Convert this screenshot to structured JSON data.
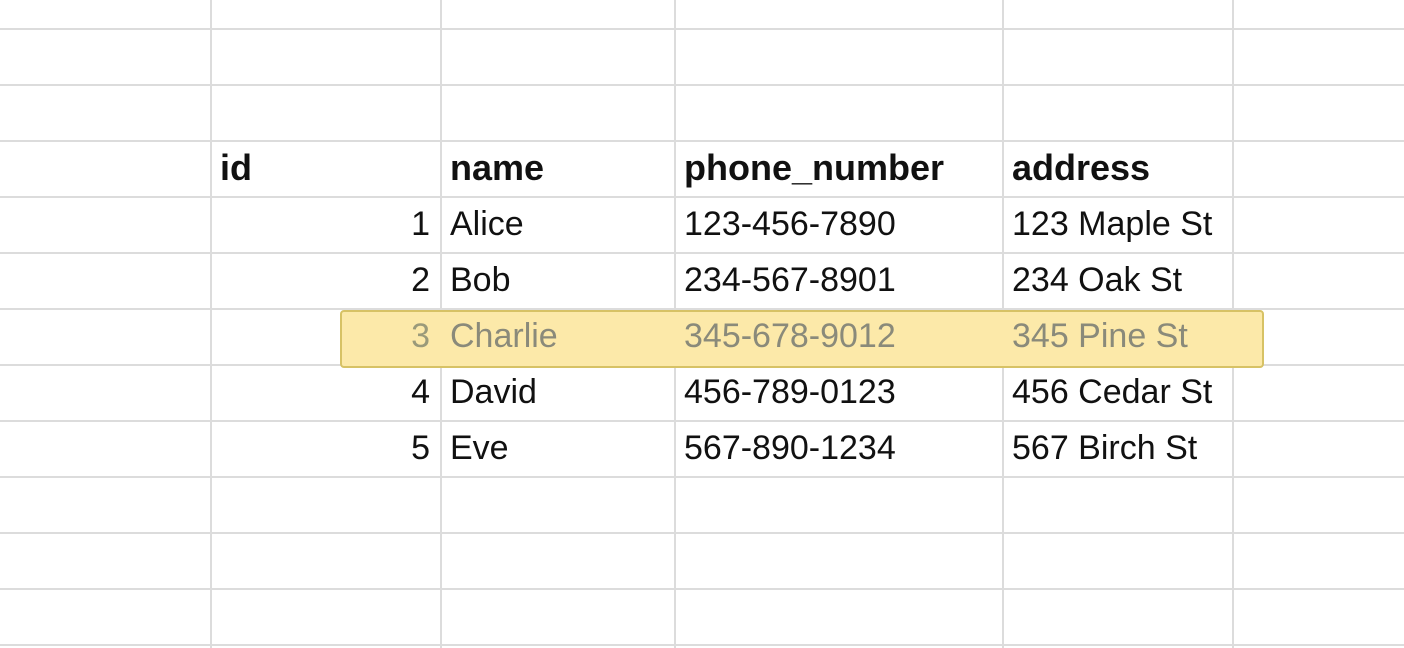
{
  "table": {
    "headers": [
      "id",
      "name",
      "phone_number",
      "address"
    ],
    "rows": [
      {
        "id": "1",
        "name": "Alice",
        "phone_number": "123-456-7890",
        "address": "123 Maple St"
      },
      {
        "id": "2",
        "name": "Bob",
        "phone_number": "234-567-8901",
        "address": "234 Oak St"
      },
      {
        "id": "3",
        "name": "Charlie",
        "phone_number": "345-678-9012",
        "address": "345 Pine St"
      },
      {
        "id": "4",
        "name": "David",
        "phone_number": "456-789-0123",
        "address": "456 Cedar St"
      },
      {
        "id": "5",
        "name": "Eve",
        "phone_number": "567-890-1234",
        "address": "567 Birch St"
      }
    ],
    "highlighted_row_index": 2
  },
  "colors": {
    "grid_line": "#dcdcdc",
    "highlight_fill": "#fce9a9",
    "highlight_border": "#d7c265"
  }
}
